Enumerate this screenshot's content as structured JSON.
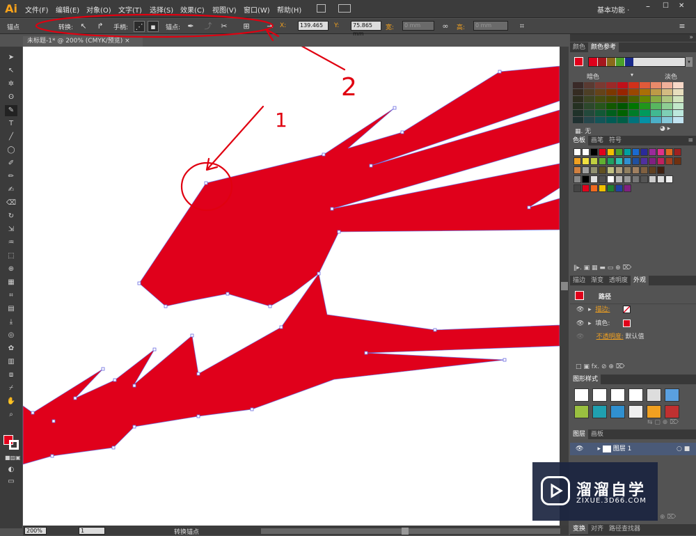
{
  "app": {
    "logo": "Ai",
    "workspace": "基本功能 ·"
  },
  "menus": [
    "文件(F)",
    "编辑(E)",
    "对象(O)",
    "文字(T)",
    "选择(S)",
    "效果(C)",
    "视图(V)",
    "窗口(W)",
    "帮助(H)"
  ],
  "control": {
    "mode": "锚点",
    "convert": "转换:",
    "handles": "手柄:",
    "anchors": "锚点:",
    "x_label": "X:",
    "x_value": "139.465",
    "y_label": "Y:",
    "y_value": "75.865 mm",
    "w_label": "宽:",
    "w_value": "0 mm",
    "h_label": "高:",
    "h_value": "0 mm"
  },
  "document": {
    "tab": "未标题-1* @ 200% (CMYK/预览)"
  },
  "status": {
    "zoom": "200%",
    "page": "1",
    "tool": "转换锚点"
  },
  "annotations": [
    "1",
    "2"
  ],
  "colors": {
    "accent": "#e0001b",
    "annot": "#e00010",
    "path": "#7070e0"
  },
  "panels": {
    "color_tabs": [
      "颜色",
      "颜色参考"
    ],
    "guide_dark": "暗色",
    "guide_light": "淡色",
    "guide_none": "无",
    "swatch_tabs": [
      "色板",
      "画笔",
      "符号"
    ],
    "appearance_tabs": [
      "描边",
      "渐变",
      "透明度",
      "外观"
    ],
    "appearance": {
      "title": "路径",
      "stroke": "描边:",
      "fill": "填色:",
      "opacity": "不透明度:",
      "opacity_value": "默认值"
    },
    "styles_tab": "图形样式",
    "layers_tabs": [
      "图层",
      "画板"
    ],
    "layer_name": "图层 1",
    "bottom_tabs": [
      "变换",
      "对齐",
      "路径查找器"
    ]
  },
  "watermark": {
    "title": "溜溜自学",
    "url": "ZIXUE.3D66.COM"
  }
}
